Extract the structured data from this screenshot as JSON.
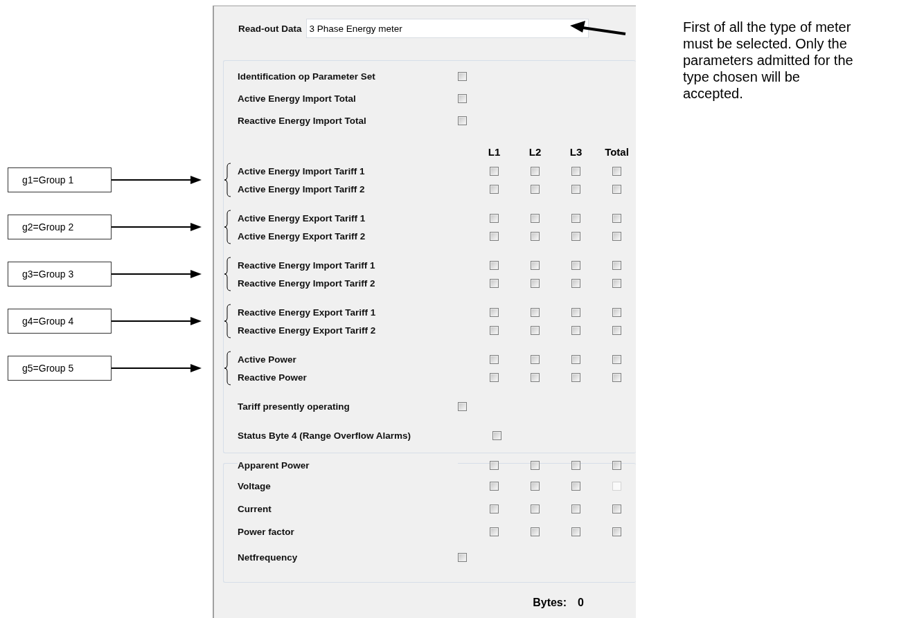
{
  "read_out_data": {
    "label": "Read-out Data",
    "value": "3 Phase Energy meter"
  },
  "note": "First of all the type of meter must be selected. Only the parameters admitted for the type chosen will be accepted.",
  "parameters": {
    "top_items": [
      {
        "label": "Identification op Parameter Set",
        "checked": false
      },
      {
        "label": "Active Energy Import Total",
        "checked": false
      },
      {
        "label": "Reactive Energy Import Total",
        "checked": false
      }
    ],
    "columns": [
      "L1",
      "L2",
      "L3",
      "Total"
    ],
    "groups": [
      {
        "callout": "g1=Group 1",
        "rows": [
          {
            "label": "Active Energy Import Tariff 1",
            "cells": [
              {
                "checked": false
              },
              {
                "checked": false
              },
              {
                "checked": false
              },
              {
                "checked": false
              }
            ]
          },
          {
            "label": "Active Energy Import Tariff 2",
            "cells": [
              {
                "checked": false
              },
              {
                "checked": false
              },
              {
                "checked": false
              },
              {
                "checked": false
              }
            ]
          }
        ]
      },
      {
        "callout": "g2=Group 2",
        "rows": [
          {
            "label": "Active Energy Export Tariff 1",
            "cells": [
              {
                "checked": false
              },
              {
                "checked": false
              },
              {
                "checked": false
              },
              {
                "checked": false
              }
            ]
          },
          {
            "label": "Active Energy Export Tariff 2",
            "cells": [
              {
                "checked": false
              },
              {
                "checked": false
              },
              {
                "checked": false
              },
              {
                "checked": false
              }
            ]
          }
        ]
      },
      {
        "callout": "g3=Group 3",
        "rows": [
          {
            "label": "Reactive Energy Import Tariff 1",
            "cells": [
              {
                "checked": false
              },
              {
                "checked": false
              },
              {
                "checked": false
              },
              {
                "checked": false
              }
            ]
          },
          {
            "label": "Reactive Energy Import Tariff 2",
            "cells": [
              {
                "checked": false
              },
              {
                "checked": false
              },
              {
                "checked": false
              },
              {
                "checked": false
              }
            ]
          }
        ]
      },
      {
        "callout": "g4=Group 4",
        "rows": [
          {
            "label": "Reactive Energy Export Tariff 1",
            "cells": [
              {
                "checked": false
              },
              {
                "checked": false
              },
              {
                "checked": false
              },
              {
                "checked": false
              }
            ]
          },
          {
            "label": "Reactive Energy Export Tariff 2",
            "cells": [
              {
                "checked": false
              },
              {
                "checked": false
              },
              {
                "checked": false
              },
              {
                "checked": false
              }
            ]
          }
        ]
      },
      {
        "callout": "g5=Group 5",
        "rows": [
          {
            "label": "Active Power",
            "cells": [
              {
                "checked": false
              },
              {
                "checked": false
              },
              {
                "checked": false
              },
              {
                "checked": false
              }
            ]
          },
          {
            "label": "Reactive Power",
            "cells": [
              {
                "checked": false
              },
              {
                "checked": false
              },
              {
                "checked": false
              },
              {
                "checked": false
              }
            ]
          }
        ]
      }
    ],
    "bottom_items": [
      {
        "label": "Tariff presently operating",
        "checked": false
      },
      {
        "label": "Status Byte 4 (Range Overflow Alarms)",
        "checked": false
      }
    ]
  },
  "apparent": {
    "rows": [
      {
        "label": "Apparent Power",
        "cells": [
          {
            "checked": false,
            "disabled": false
          },
          {
            "checked": false,
            "disabled": false
          },
          {
            "checked": false,
            "disabled": false
          },
          {
            "checked": false,
            "disabled": false
          }
        ]
      },
      {
        "label": "Voltage",
        "cells": [
          {
            "checked": false,
            "disabled": false
          },
          {
            "checked": false,
            "disabled": false
          },
          {
            "checked": false,
            "disabled": false
          },
          {
            "checked": false,
            "disabled": true
          }
        ]
      },
      {
        "label": "Current",
        "cells": [
          {
            "checked": false,
            "disabled": false
          },
          {
            "checked": false,
            "disabled": false
          },
          {
            "checked": false,
            "disabled": false
          },
          {
            "checked": false,
            "disabled": false
          }
        ]
      },
      {
        "label": "Power factor",
        "cells": [
          {
            "checked": false,
            "disabled": false
          },
          {
            "checked": false,
            "disabled": false
          },
          {
            "checked": false,
            "disabled": false
          },
          {
            "checked": false,
            "disabled": false
          }
        ]
      },
      {
        "label": "Netfrequency",
        "cells": [
          {
            "checked": false,
            "disabled": false
          }
        ]
      }
    ]
  },
  "bytes": {
    "label": "Bytes:",
    "value": "0"
  }
}
